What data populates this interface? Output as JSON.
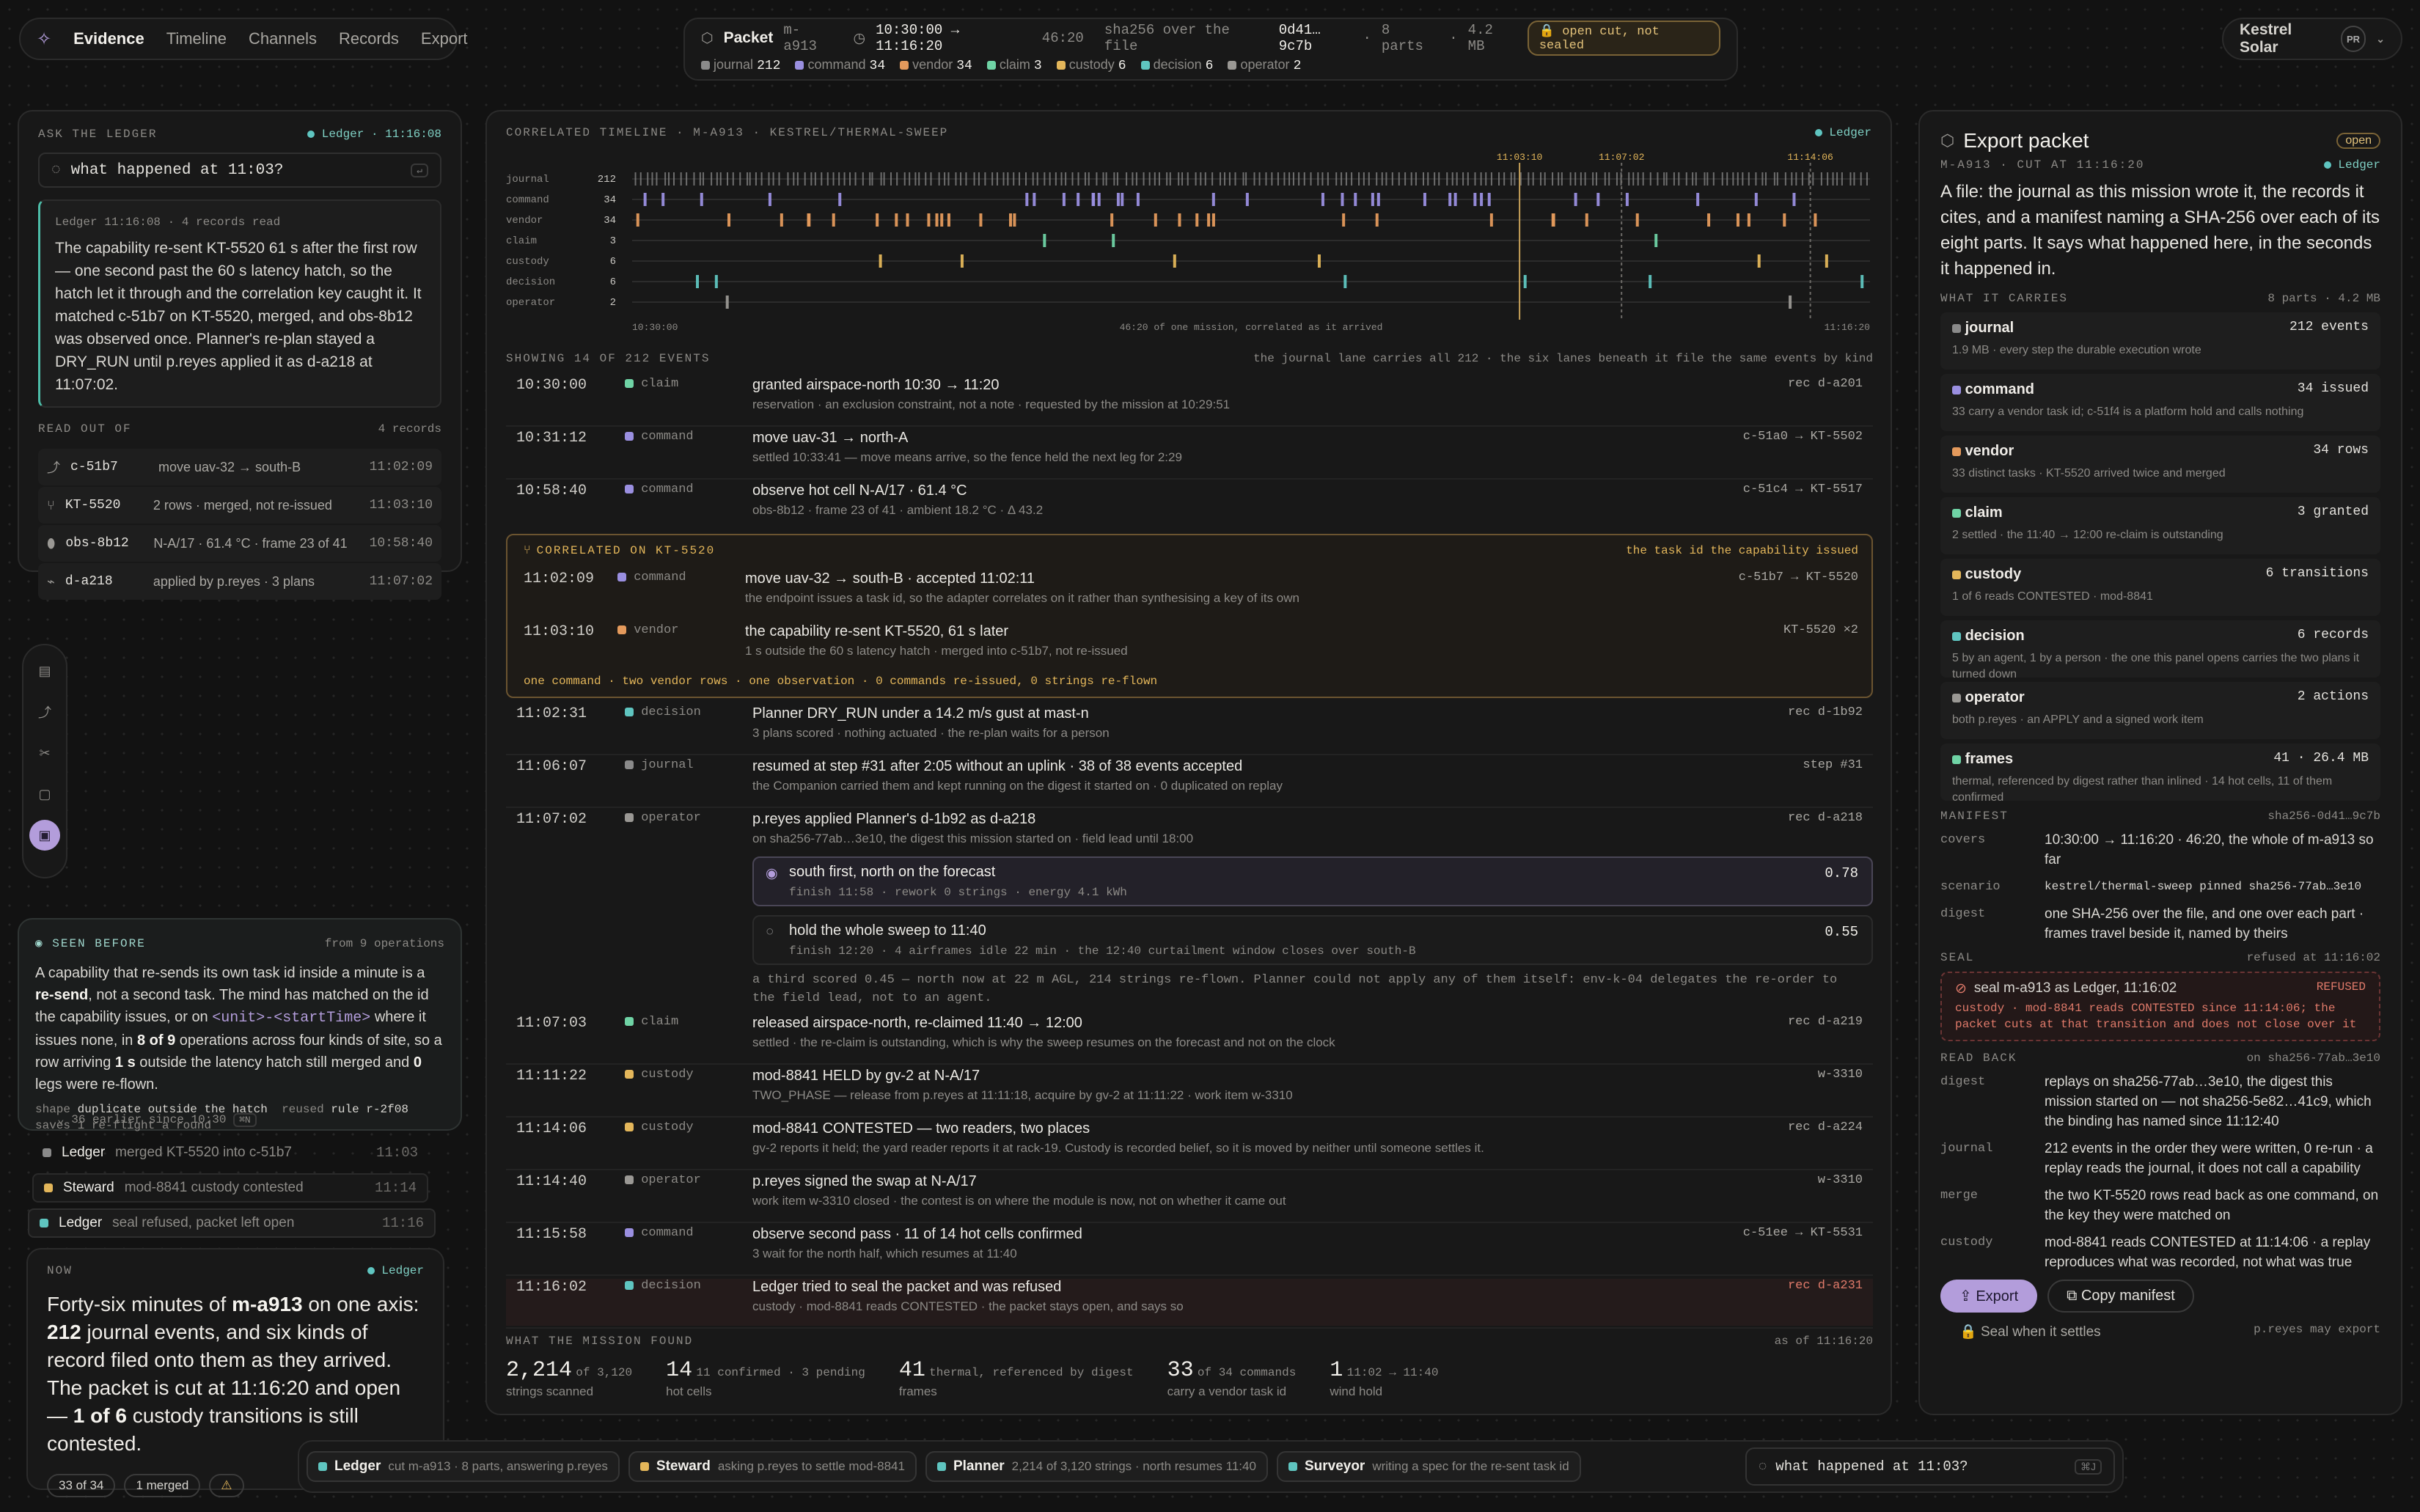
{
  "nav": {
    "title": "Evidence",
    "items": [
      "Timeline",
      "Channels",
      "Records",
      "Export"
    ]
  },
  "packet": {
    "label": "Packet",
    "id": "m-a913",
    "range": "10:30:00 → 11:16:20",
    "dur": "46:20",
    "hash": "sha256 over the file",
    "hashv": "0d41…9c7b",
    "parts": "8 parts",
    "size": "4.2 MB",
    "status": "open cut, not sealed",
    "counts": [
      {
        "k": "journal",
        "v": "212",
        "c": "#8a8a8a"
      },
      {
        "k": "command",
        "v": "34",
        "c": "#9a8fe0"
      },
      {
        "k": "vendor",
        "v": "34",
        "c": "#e49a5c"
      },
      {
        "k": "claim",
        "v": "3",
        "c": "#6fd3a5"
      },
      {
        "k": "custody",
        "v": "6",
        "c": "#e3b65a"
      },
      {
        "k": "decision",
        "v": "6",
        "c": "#5fc5c0"
      },
      {
        "k": "operator",
        "v": "2",
        "c": "#9a9894"
      }
    ]
  },
  "brand": {
    "name": "Kestrel Solar",
    "avatar": "PR"
  },
  "ask": {
    "cap": "ASK THE LEDGER",
    "status": "Ledger · 11:16:08",
    "query": "what happened at 11:03?",
    "meta": "Ledger 11:16:08 · 4 records read",
    "answer": "The capability re-sent KT-5520 61 s after the first row — one second past the 60 s latency hatch, so the hatch let it through and the correlation key caught it. It matched c-51b7 on KT-5520, merged, and obs-8b12 was observed once. Planner's re-plan stayed a DRY_RUN until p.reyes applied it as d-a218 at 11:07:02.",
    "readcap": "READ OUT OF",
    "readcount": "4 records",
    "reads": [
      {
        "k": "c-51b7",
        "v": "move uav-32 → south-B",
        "t": "11:02:09"
      },
      {
        "k": "KT-5520",
        "v": "2 rows · merged, not re-issued",
        "t": "11:03:10"
      },
      {
        "k": "obs-8b12",
        "v": "N-A/17 · 61.4 °C · frame 23 of 41",
        "t": "10:58:40"
      },
      {
        "k": "d-a218",
        "v": "applied by p.reyes · 3 plans",
        "t": "11:07:02"
      }
    ]
  },
  "seen": {
    "cap": "SEEN BEFORE",
    "from": "from 9 operations",
    "text1": "A capability that re-sends its own task id inside a minute is a",
    "re": "re-send",
    "text2": ", not a second task. The mind has matched on the id the capability issues, or on",
    "unit": "<unit>-<startTime>",
    "text3": "where it issues none, in",
    "frac": "8 of 9",
    "text4": "operations across four kinds of site, so a row arriving",
    "one": "1 s",
    "text5": "outside the latency hatch still merged and",
    "zero": "0",
    "text6": "legs were re-flown.",
    "shape": "shape",
    "shapev": "duplicate outside the hatch",
    "reused": "reused",
    "rule": "rule r-2f08",
    "saves": "saves 1 re-flight a round",
    "earlier": "36 earlier since 10:30",
    "key": "⌘N"
  },
  "feed": [
    {
      "who": "Ledger",
      "what": "merged KT-5520 into c-51b7",
      "t": "11:03",
      "c": "#8a8a8a"
    },
    {
      "who": "Steward",
      "what": "mod-8841 custody contested",
      "t": "11:14",
      "c": "#e3b65a"
    },
    {
      "who": "Ledger",
      "what": "seal refused, packet left open",
      "t": "11:16",
      "c": "#5fc5c0"
    }
  ],
  "now": {
    "cap": "NOW",
    "who": "Ledger",
    "a": "Forty-six minutes of",
    "b": "m-a913",
    "c": "on one axis:",
    "d": "212",
    "e": "journal events, and six kinds of record filed onto them as they arrived. The packet is cut at 11:16:20 and open —",
    "f": "1 of 6",
    "g": "custody transitions is still contested.",
    "chips": [
      "33 of 34",
      "1 merged",
      "⚠"
    ]
  },
  "timeline": {
    "cap": "CORRELATED TIMELINE · M-A913 · KESTREL/THERMAL-SWEEP",
    "status": "Ledger",
    "start": "10:30:00",
    "end": "11:16:20",
    "mid": "46:20 of one mission, correlated as it arrived",
    "marks": [
      "11:03:10",
      "11:07:02",
      "11:14:06"
    ],
    "lanes": [
      {
        "k": "journal",
        "v": "212"
      },
      {
        "k": "command",
        "v": "34"
      },
      {
        "k": "vendor",
        "v": "34"
      },
      {
        "k": "claim",
        "v": "3"
      },
      {
        "k": "custody",
        "v": "6"
      },
      {
        "k": "decision",
        "v": "6"
      },
      {
        "k": "operator",
        "v": "2"
      }
    ],
    "showing": "SHOWING 14 OF 212 EVENTS",
    "note": "the journal lane carries all 212 · the six lanes beneath it file the same events by kind"
  },
  "rows": [
    {
      "t": "10:30:00",
      "k": "claim",
      "c": "#6fd3a5",
      "ti": "granted airspace-north 10:30 → 11:20",
      "sb": "reservation · an exclusion constraint, not a note · requested by the mission at 10:29:51",
      "rf": "rec d-a201"
    },
    {
      "t": "10:31:12",
      "k": "command",
      "c": "#9a8fe0",
      "ti": "move uav-31 → north-A",
      "sb": "settled 10:33:41 — move means arrive, so the fence held the next leg for 2:29",
      "rf": "c-51a0 → KT-5502"
    },
    {
      "t": "10:58:40",
      "k": "command",
      "c": "#9a8fe0",
      "ti": "observe hot cell N-A/17 · 61.4 °C",
      "sb": "obs-8b12 · frame 23 of 41 · ambient 18.2 °C · Δ 43.2",
      "rf": "c-51c4 → KT-5517"
    },
    {
      "t": "11:02:31",
      "k": "decision",
      "c": "#5fc5c0",
      "ti": "Planner DRY_RUN under a 14.2 m/s gust at mast-n",
      "sb": "3 plans scored · nothing actuated · the re-plan waits for a person",
      "rf": "rec d-1b92"
    },
    {
      "t": "11:06:07",
      "k": "journal",
      "c": "#8a8a8a",
      "ti": "resumed at step #31 after 2:05 without an uplink · 38 of 38 events accepted",
      "sb": "the Companion carried them and kept running on the digest it started on · 0 duplicated on replay",
      "rf": "step #31"
    },
    {
      "t": "11:07:02",
      "k": "operator",
      "c": "#9a9894",
      "ti": "p.reyes applied Planner's d-1b92 as d-a218",
      "sb": "on sha256-77ab…3e10, the digest this mission started on · field lead until 18:00",
      "rf": "rec d-a218"
    },
    {
      "t": "11:07:03",
      "k": "claim",
      "c": "#6fd3a5",
      "ti": "released airspace-north, re-claimed 11:40 → 12:00",
      "sb": "settled · the re-claim is outstanding, which is why the sweep resumes on the forecast and not on the clock",
      "rf": "rec d-a219"
    },
    {
      "t": "11:11:22",
      "k": "custody",
      "c": "#e3b65a",
      "ti": "mod-8841 HELD by gv-2 at N-A/17",
      "sb": "TWO_PHASE — release from p.reyes at 11:11:18, acquire by gv-2 at 11:11:22 · work item w-3310",
      "rf": "w-3310"
    },
    {
      "t": "11:14:06",
      "k": "custody",
      "c": "#e3b65a",
      "ti": "mod-8841 CONTESTED — two readers, two places",
      "sb": "gv-2 reports it held; the yard reader reports it at rack-19. Custody is recorded belief, so it is moved by neither until someone settles it.",
      "rf": "rec d-a224"
    },
    {
      "t": "11:14:40",
      "k": "operator",
      "c": "#9a9894",
      "ti": "p.reyes signed the swap at N-A/17",
      "sb": "work item w-3310 closed · the contest is on where the module is now, not on whether it came out",
      "rf": "w-3310"
    },
    {
      "t": "11:15:58",
      "k": "command",
      "c": "#9a8fe0",
      "ti": "observe second pass · 11 of 14 hot cells confirmed",
      "sb": "3 wait for the north half, which resumes at 11:40",
      "rf": "c-51ee → KT-5531"
    },
    {
      "t": "11:16:02",
      "k": "decision",
      "c": "#5fc5c0",
      "ti": "Ledger tried to seal the packet and was refused",
      "sb": "custody · mod-8841 reads CONTESTED · the packet stays open, and says so",
      "rf": "rec d-a231"
    }
  ],
  "corr": {
    "cap": "CORRELATED ON KT-5520",
    "note": "the task id the capability issued",
    "r1": {
      "t": "11:02:09",
      "k": "command",
      "ti": "move uav-32 → south-B · accepted 11:02:11",
      "sb": "the endpoint issues a task id, so the adapter correlates on it rather than synthesising a key of its own",
      "rf": "c-51b7 → KT-5520"
    },
    "r2": {
      "t": "11:03:10",
      "k": "vendor",
      "ti": "the capability re-sent KT-5520, 61 s later",
      "sb": "1 s outside the 60 s latency hatch · merged into c-51b7, not re-issued",
      "rf": "KT-5520 ×2"
    },
    "foot": "one command · two vendor rows · one observation · 0 commands re-issued, 0 strings re-flown"
  },
  "plans": [
    {
      "t": "south first, north on the forecast",
      "s": "finish 11:58 · rework 0 strings · energy 4.1 kWh",
      "v": "0.78"
    },
    {
      "t": "hold the whole sweep to 11:40",
      "s": "finish 12:20 · 4 airframes idle 22 min · the 12:40 curtailment window closes over south-B",
      "v": "0.55"
    }
  ],
  "third": "a third scored 0.45 — north now at 22 m AGL, 214 strings re-flown. Planner could not apply any of them itself: env-k-04 delegates the re-order to the field lead, not to an agent.",
  "found": {
    "cap": "WHAT THE MISSION FOUND",
    "asof": "as of 11:16:20",
    "stats": [
      {
        "v": "2,214",
        "x": "of 3,120",
        "s": "strings scanned"
      },
      {
        "v": "14",
        "x": "11 confirmed · 3 pending",
        "s": "hot cells"
      },
      {
        "v": "41",
        "x": "thermal, referenced by digest",
        "s": "frames"
      },
      {
        "v": "33",
        "x": "of 34 commands",
        "s": "carry a vendor task id"
      },
      {
        "v": "1",
        "x": "11:02 → 11:40",
        "s": "wind hold"
      }
    ]
  },
  "export": {
    "title": "Export packet",
    "badge": "open",
    "sub": "M-A913 · CUT AT 11:16:20",
    "who": "Ledger",
    "lead": "A file: the journal as this mission wrote it, the records it cites, and a manifest naming a SHA-256 over each of its eight parts. It says what happened here, in the seconds it happened in.",
    "carr": "WHAT IT CARRIES",
    "carrn": "8 parts · 4.2 MB",
    "parts": [
      {
        "n": "journal",
        "c": "212 events",
        "d": "1.9 MB · every step the durable execution wrote",
        "col": "#8a8a8a"
      },
      {
        "n": "command",
        "c": "34 issued",
        "d": "33 carry a vendor task id; c-51f4 is a platform hold and calls nothing",
        "col": "#9a8fe0"
      },
      {
        "n": "vendor",
        "c": "34 rows",
        "d": "33 distinct tasks · KT-5520 arrived twice and merged",
        "col": "#e49a5c"
      },
      {
        "n": "claim",
        "c": "3 granted",
        "d": "2 settled · the 11:40 → 12:00 re-claim is outstanding",
        "col": "#6fd3a5"
      },
      {
        "n": "custody",
        "c": "6 transitions",
        "d": "1 of 6 reads CONTESTED · mod-8841",
        "col": "#e3b65a"
      },
      {
        "n": "decision",
        "c": "6 records",
        "d": "5 by an agent, 1 by a person · the one this panel opens carries the two plans it turned down",
        "col": "#5fc5c0"
      },
      {
        "n": "operator",
        "c": "2 actions",
        "d": "both p.reyes · an APPLY and a signed work item",
        "col": "#9a9894"
      },
      {
        "n": "frames",
        "c": "41 · 26.4 MB",
        "d": "thermal, referenced by digest rather than inlined · 14 hot cells, 11 of them confirmed",
        "col": "#6fd3a5"
      }
    ],
    "man": "MANIFEST",
    "manv": "sha256-0d41…9c7b",
    "covers": "10:30:00 → 11:16:20 · 46:20, the whole of m-a913 so far",
    "scenario": "kestrel/thermal-sweep pinned sha256-77ab…3e10",
    "digest": "one SHA-256 over the file, and one over each part · frames travel beside it, named by theirs",
    "seal": "SEAL",
    "sealv": "refused at 11:16:02",
    "sealmsg": "seal m-a913 as Ledger, 11:16:02",
    "refused": "REFUSED",
    "sealwhy": "custody · mod-8841 reads CONTESTED since 11:14:06; the packet cuts at that transition and does not close over it",
    "rb": "READ BACK",
    "rbv": "on sha256-77ab…3e10",
    "rbd": "replays on sha256-77ab…3e10, the digest this mission started on — not sha256-5e82…41c9, which the binding has named since 11:12:40",
    "rbj": "212 events in the order they were written, 0 re-run · a replay reads the journal, it does not call a capability",
    "rbm": "the two KT-5520 rows read back as one command, on the key they were matched on",
    "rbc": "mod-8841 reads CONTESTED at 11:14:06 · a replay reproduces what was recorded, not what was true",
    "export_btn": "Export",
    "copy_btn": "Copy manifest",
    "seal_btn": "Seal when it settles",
    "may": "p.reyes may export"
  },
  "agents": [
    {
      "n": "Ledger",
      "s": "cut m-a913 · 8 parts, answering p.reyes",
      "c": "#5fc5c0"
    },
    {
      "n": "Steward",
      "s": "asking p.reyes to settle mod-8841",
      "c": "#e3b65a"
    },
    {
      "n": "Planner",
      "s": "2,214 of 3,120 strings · north resumes 11:40",
      "c": "#5fc5c0"
    },
    {
      "n": "Surveyor",
      "s": "writing a spec for the re-sent task id",
      "c": "#5fc5c0"
    }
  ],
  "cmd": {
    "q": "what happened at 11:03?",
    "k": "⌘J"
  }
}
